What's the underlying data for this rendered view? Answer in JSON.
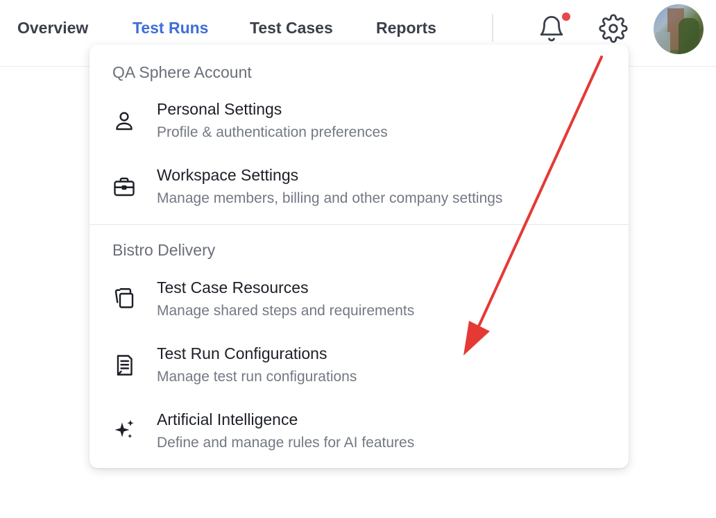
{
  "nav": {
    "tabs": [
      {
        "label": "Overview",
        "active": false
      },
      {
        "label": "Test Runs",
        "active": true
      },
      {
        "label": "Test Cases",
        "active": false
      },
      {
        "label": "Reports",
        "active": false
      }
    ],
    "icons": {
      "notifications": "bell-icon",
      "settings": "gear-icon",
      "profile": "avatar"
    },
    "notification_dot_color": "#e5484d"
  },
  "menu": {
    "sections": [
      {
        "title": "QA Sphere Account",
        "items": [
          {
            "icon": "user-icon",
            "title": "Personal Settings",
            "description": "Profile & authentication preferences"
          },
          {
            "icon": "briefcase-icon",
            "title": "Workspace Settings",
            "description": "Manage members, billing and other company settings"
          }
        ]
      },
      {
        "title": "Bistro Delivery",
        "items": [
          {
            "icon": "documents-icon",
            "title": "Test Case Resources",
            "description": "Manage shared steps and requirements"
          },
          {
            "icon": "document-list-icon",
            "title": "Test Run Configurations",
            "description": "Manage test run configurations"
          },
          {
            "icon": "sparkles-icon",
            "title": "Artificial Intelligence",
            "description": "Define and manage rules for AI features"
          }
        ]
      }
    ]
  },
  "colors": {
    "accent": "#3d6fd8",
    "annotation_arrow": "#e53935"
  }
}
